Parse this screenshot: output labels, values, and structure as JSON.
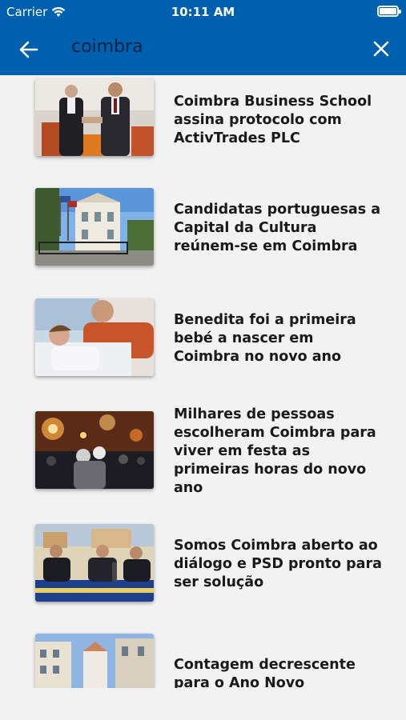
{
  "status": {
    "carrier": "Carrier",
    "time": "10:11 AM"
  },
  "search": {
    "query": "coimbra"
  },
  "results": [
    {
      "title": "Coimbra Business School assina protocolo com ActivTrades PLC"
    },
    {
      "title": "Candidatas portuguesas a Capital da Cultura reúnem-se em Coimbra"
    },
    {
      "title": "Benedita foi a primeira bebé a nascer em Coimbra no novo ano"
    },
    {
      "title": "Milhares de pessoas escolheram Coimbra para viver em festa as primeiras horas do novo ano"
    },
    {
      "title": "Somos Coimbra aberto ao diálogo e PSD pronto para ser solução"
    },
    {
      "title": "Contagem  decrescente para o Ano Novo"
    }
  ],
  "colors": {
    "header": "#0060b0",
    "background": "#f2f2f2",
    "title_text": "#1a1a1a",
    "query_text": "#0c2340"
  }
}
